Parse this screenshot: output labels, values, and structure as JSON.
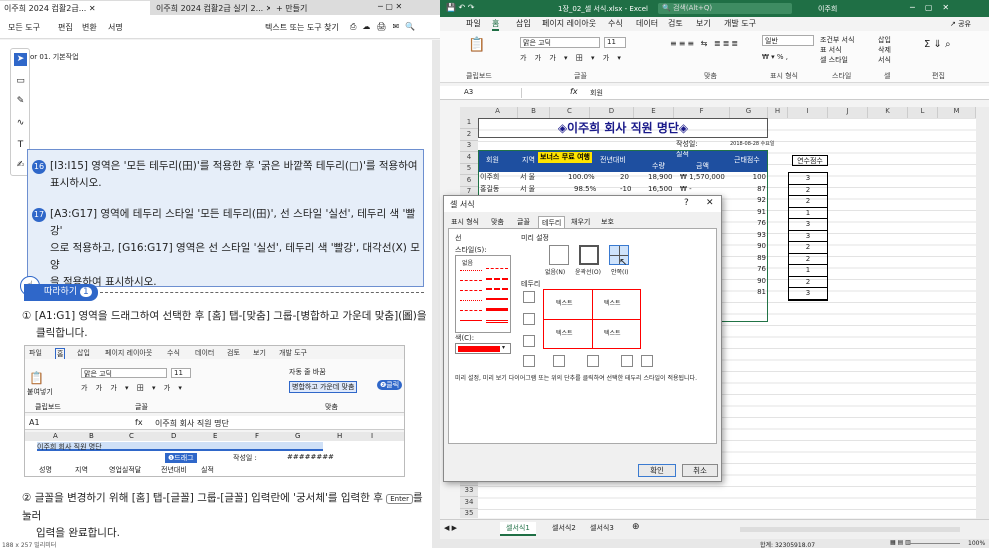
{
  "pdf": {
    "tabs": [
      "이주희 2024 컴활2급...",
      "이주희 2024 컴활2급 실기 2..."
    ],
    "new_tab": "+ 만들기",
    "menu": [
      "모든 도구",
      "편집",
      "변환",
      "서명"
    ],
    "search_placeholder": "텍스트 또는 도구 찾기",
    "chapter": "or 01. 기본작업",
    "items": [
      {
        "num": "16",
        "line1": "[I3:I15] 영역은 '모든 테두리(田)'를 적용한 후 '굵은 바깥쪽 테두리(□)'를 적용하여",
        "line2": "표시하시오."
      },
      {
        "num": "17",
        "line1": "[A3:G17] 영역에 테두리 스타일 '모든 테두리(田)', 선 스타일 '실선', 테두리 색 '빨강'",
        "line2": "으로 적용하고, [G16:G17] 영역은 선 스타일 '실선', 테두리 색 '빨강', 대각선(X) 모양",
        "line3": "을 적용하여 표시하시오."
      }
    ],
    "follow_label": "따라하기",
    "follow_num": "1",
    "step1_line1": "① [A1:G1] 영역을 드래그하여 선택한 후 [홈] 탭-[맞춤] 그룹-[병합하고 가운데 맞춤](圖)을",
    "step1_line2": "클릭합니다.",
    "step2_line1": "② 글꼴을 변경하기 위해 [홈] 탭-[글꼴] 그룹-[글꼴] 입력란에 '궁서체'를 입력한 후",
    "enter_key": "Enter",
    "step2_tail": "를 눌러",
    "step2_line2": "입력을 완료합니다.",
    "page_size": "188 x 257 밀리미터",
    "mini": {
      "tabs": [
        "파일",
        "홈",
        "삽입",
        "페이지 레이아웃",
        "수식",
        "데이터",
        "검토",
        "보기",
        "개발 도구"
      ],
      "font": "맑은 고딕",
      "size": "11",
      "wrap": "자동 줄 바꿈",
      "merge": "병합하고 가운데 맞춤",
      "badge2": "❷클릭",
      "paste": "붙여넣기",
      "groups": [
        "클립보드",
        "글꼴",
        "맞춤"
      ],
      "cellref": "A1",
      "formula": "이주희 회사 직원 명단",
      "cols": [
        "A",
        "B",
        "C",
        "D",
        "E",
        "F",
        "G",
        "H",
        "I"
      ],
      "row1": "이주희 회사 직원 명단",
      "drag": "❶드래그",
      "created": "작성일 :",
      "hash": "########",
      "row3": [
        "성명",
        "지역",
        "영업실적달",
        "전년대비",
        "실적"
      ]
    }
  },
  "excel": {
    "title": "1장_02_셀 서식.xlsx - Excel",
    "search": "검색(Alt+Q)",
    "user": "이주희",
    "tabs": [
      "파일",
      "홈",
      "삽입",
      "페이지 레이아웃",
      "수식",
      "데이터",
      "검토",
      "보기",
      "개발 도구"
    ],
    "font": "맑은 고딕",
    "size": "11",
    "numfmt": "일반",
    "groups": [
      "클립보드",
      "글꼴",
      "맞춤",
      "표시 형식",
      "스타일",
      "셀",
      "편집"
    ],
    "style_items": [
      "조건부 서식",
      "표 서식",
      "셀 스타일"
    ],
    "cell_items": [
      "삽입",
      "삭제",
      "서식"
    ],
    "cellref": "A3",
    "formula": "회원",
    "share": "공유",
    "cols": [
      "A",
      "B",
      "C",
      "D",
      "E",
      "F",
      "G",
      "H",
      "I",
      "J",
      "K",
      "L",
      "M"
    ],
    "rows": [
      "1",
      "2",
      "3",
      "4",
      "5",
      "6",
      "7",
      "8",
      "9",
      "10",
      "11",
      "12",
      "13",
      "14",
      "15",
      "16",
      "17",
      "18",
      "19",
      "20",
      "21",
      "22",
      "23",
      "24",
      "25",
      "26",
      "27",
      "28",
      "29",
      "30",
      "31",
      "32",
      "33",
      "34",
      "35",
      "36"
    ],
    "sheet_title": "◈이주희 회사 직원 명단◈",
    "created": "작성일:",
    "date_note": "2018-08-28 수요일",
    "header": [
      "회원",
      "지역",
      "보너스 무료 여행",
      "전년대비",
      "실적",
      "금액",
      "근태점수"
    ],
    "sub_header": [
      "수량",
      "금액"
    ],
    "row5": [
      "이주희",
      "서 울",
      "100.0%",
      "20",
      "18,900",
      "₩ 1,570,000",
      "100"
    ],
    "row6": [
      "홍길동",
      "서 울",
      "98.5%",
      "-10",
      "16,500",
      "₩ -",
      "87"
    ],
    "g_values": [
      "100",
      "87",
      "92",
      "91",
      "76",
      "93",
      "90",
      "89",
      "76",
      "90",
      "81"
    ],
    "i_header": "연수점수",
    "i_values": [
      "3",
      "2",
      "2",
      "1",
      "3",
      "3",
      "2",
      "2",
      "1",
      "2",
      "3"
    ],
    "sheet_tabs": [
      "셀서식1",
      "셀서식2",
      "셀서식3"
    ],
    "sum": "합계: 32305918.07",
    "zoom": "100%"
  },
  "dialog": {
    "title": "셀 서식",
    "tabs": [
      "표시 형식",
      "맞춤",
      "글꼴",
      "테두리",
      "채우기",
      "보호"
    ],
    "line_label": "선",
    "style_label": "스타일(S):",
    "none_label": "없음",
    "preset_label": "미리 설정",
    "presets": [
      "없음(N)",
      "윤곽선(O)",
      "안쪽(I)"
    ],
    "border_label": "테두리",
    "preview_texts": [
      "텍스트",
      "텍스트",
      "텍스트",
      "텍스트"
    ],
    "color_label": "색(C):",
    "color": "#ff0000",
    "help": "미리 설정, 미리 보기 다이어그램 또는 위의 단추를 클릭하여 선택한 테두리 스타일이 적용됩니다.",
    "ok": "확인",
    "cancel": "취소"
  }
}
